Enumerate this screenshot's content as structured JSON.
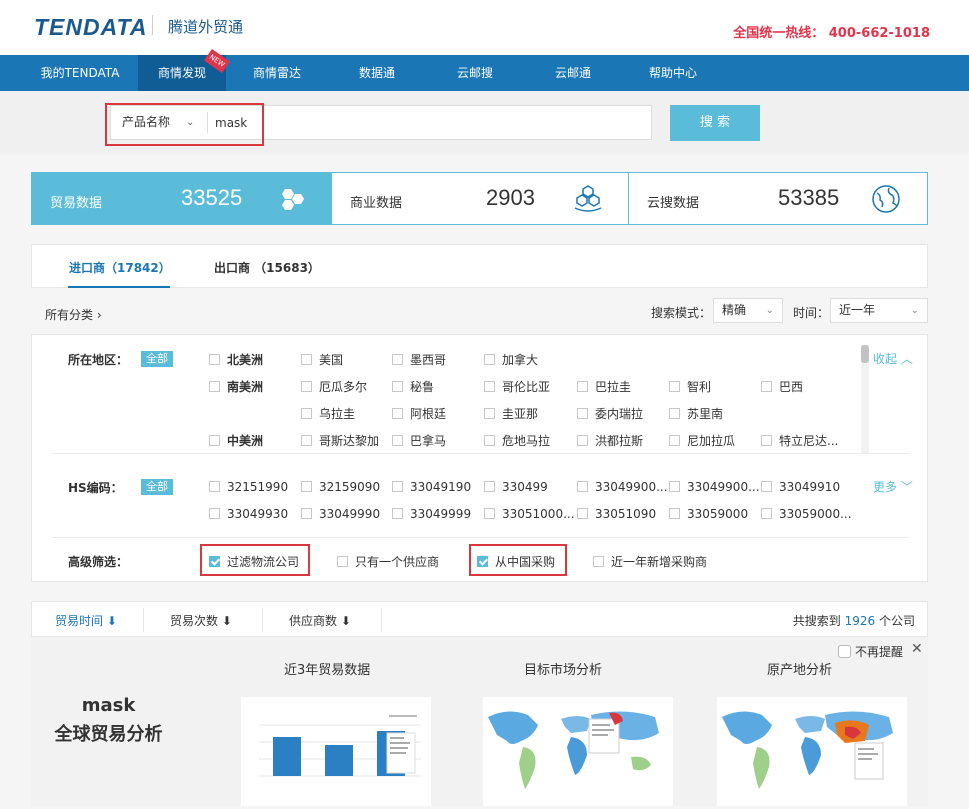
{
  "header": {
    "logo": "TENDATA",
    "subtitle": "腾道外贸通",
    "hotline": "全国统一热线： 400-662-1018"
  },
  "nav": {
    "items": [
      "我的TENDATA",
      "商情发现",
      "商情雷达",
      "数据通",
      "云邮搜",
      "云邮通",
      "帮助中心"
    ],
    "active": "商情发现",
    "new_badge": "NEW"
  },
  "search": {
    "type_label": "产品名称",
    "query": "mask",
    "button": "搜 索"
  },
  "stats": [
    {
      "label": "贸易数据",
      "value": "33525",
      "icon": "hexagon-cluster-icon"
    },
    {
      "label": "商业数据",
      "value": "2903",
      "icon": "cubes-hand-icon"
    },
    {
      "label": "云搜数据",
      "value": "53385",
      "icon": "globe-icon"
    }
  ],
  "tabs": [
    {
      "label": "进口商（17842）"
    },
    {
      "label": "出口商 （15683）"
    }
  ],
  "filter_bar": {
    "all_categories": "所有分类 ›",
    "mode_label": "搜索模式：",
    "mode_value": "精确",
    "time_label": "时间：",
    "time_value": "近一年"
  },
  "region": {
    "label": "所在地区：",
    "all": "全部",
    "collapse": "收起 ︿",
    "rows": [
      [
        "北美洲",
        "美国",
        "墨西哥",
        "加拿大"
      ],
      [
        "南美洲",
        "厄瓜多尔",
        "秘鲁",
        "哥伦比亚",
        "巴拉圭",
        "智利",
        "巴西"
      ],
      [
        "乌拉圭",
        "阿根廷",
        "圭亚那",
        "委内瑞拉",
        "苏里南"
      ],
      [
        "中美洲",
        "哥斯达黎加",
        "巴拿马",
        "危地马拉",
        "洪都拉斯",
        "尼加拉瓜",
        "特立尼达..."
      ]
    ]
  },
  "hs": {
    "label": "HS编码：",
    "all": "全部",
    "more": "更多 ﹀",
    "rows": [
      [
        "32151990",
        "32159090",
        "33049190",
        "330499",
        "33049900...",
        "33049900...",
        "33049910"
      ],
      [
        "33049930",
        "33049990",
        "33049999",
        "33051000...",
        "33051090",
        "33059000",
        "33059000..."
      ]
    ]
  },
  "advanced": {
    "label": "高级筛选：",
    "options": [
      {
        "label": "过滤物流公司",
        "checked": true
      },
      {
        "label": "只有一个供应商",
        "checked": false
      },
      {
        "label": "从中国采购",
        "checked": true
      },
      {
        "label": "近一年新增采购商",
        "checked": false
      }
    ]
  },
  "sort": {
    "items": [
      "贸易时间 ⬇",
      "贸易次数 ⬇",
      "供应商数 ⬇"
    ],
    "total_prefix": "共搜索到 ",
    "total_num": "1926",
    "total_suffix": " 个公司"
  },
  "analysis": {
    "keyword": "mask",
    "title": "全球贸易分析",
    "no_remind": "不再提醒",
    "close": "✕",
    "cards": [
      "近3年贸易数据",
      "目标市场分析",
      "原产地分析"
    ]
  }
}
